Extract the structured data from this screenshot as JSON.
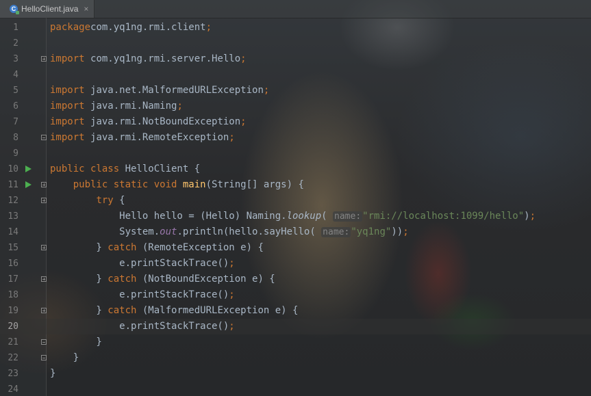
{
  "tab": {
    "icon": "java-class-icon",
    "icon_letter": "C",
    "label": "HelloClient.java",
    "close": "×"
  },
  "lines": [
    {
      "n": "1",
      "t": [
        [
          "kw",
          "package"
        ],
        [
          "",
          "com.yq1ng.rmi.client"
        ],
        [
          "kw",
          ";"
        ]
      ]
    },
    {
      "n": "2",
      "t": []
    },
    {
      "n": "3",
      "t": [
        [
          "kw",
          "import "
        ],
        [
          "",
          "com.yq1ng.rmi.server.Hello"
        ],
        [
          "kw",
          ";"
        ]
      ]
    },
    {
      "n": "4",
      "t": []
    },
    {
      "n": "5",
      "t": [
        [
          "kw",
          "import "
        ],
        [
          "",
          "java.net.MalformedURLException"
        ],
        [
          "kw",
          ";"
        ]
      ]
    },
    {
      "n": "6",
      "t": [
        [
          "kw",
          "import "
        ],
        [
          "",
          "java.rmi.Naming"
        ],
        [
          "kw",
          ";"
        ]
      ]
    },
    {
      "n": "7",
      "t": [
        [
          "kw",
          "import "
        ],
        [
          "",
          "java.rmi.NotBoundException"
        ],
        [
          "kw",
          ";"
        ]
      ]
    },
    {
      "n": "8",
      "t": [
        [
          "kw",
          "import "
        ],
        [
          "",
          "java.rmi.RemoteException"
        ],
        [
          "kw",
          ";"
        ]
      ]
    },
    {
      "n": "9",
      "t": []
    },
    {
      "n": "10",
      "t": [
        [
          "kw",
          "public class "
        ],
        [
          "",
          "HelloClient {"
        ]
      ]
    },
    {
      "n": "11",
      "t": [
        [
          "",
          "    "
        ],
        [
          "kw",
          "public static void "
        ],
        [
          "fn",
          "main"
        ],
        [
          "",
          "(String[] args) {"
        ]
      ]
    },
    {
      "n": "12",
      "t": [
        [
          "",
          "        "
        ],
        [
          "kw",
          "try "
        ],
        [
          "",
          "{"
        ]
      ]
    },
    {
      "n": "13",
      "t": [
        [
          "",
          "            Hello hello = (Hello) Naming."
        ],
        [
          "it",
          "lookup"
        ],
        [
          "",
          "( "
        ],
        [
          "hint",
          "name:"
        ],
        [
          "",
          ""
        ],
        [
          "str",
          "\"rmi://localhost:1099/hello\""
        ],
        [
          "",
          ")"
        ],
        [
          "kw",
          ";"
        ]
      ]
    },
    {
      "n": "14",
      "t": [
        [
          "",
          "            System."
        ],
        [
          "fld",
          "out"
        ],
        [
          "",
          ".println(hello.sayHello( "
        ],
        [
          "hint",
          "name:"
        ],
        [
          "",
          ""
        ],
        [
          "str",
          "\"yq1ng\""
        ],
        [
          "",
          "))"
        ],
        [
          "kw",
          ";"
        ]
      ]
    },
    {
      "n": "15",
      "t": [
        [
          "",
          "        } "
        ],
        [
          "kw",
          "catch "
        ],
        [
          "",
          "(RemoteException e) {"
        ]
      ]
    },
    {
      "n": "16",
      "t": [
        [
          "",
          "            e.printStackTrace()"
        ],
        [
          "kw",
          ";"
        ]
      ]
    },
    {
      "n": "17",
      "t": [
        [
          "",
          "        } "
        ],
        [
          "kw",
          "catch "
        ],
        [
          "",
          "(NotBoundException e) {"
        ]
      ]
    },
    {
      "n": "18",
      "t": [
        [
          "",
          "            e.printStackTrace()"
        ],
        [
          "kw",
          ";"
        ]
      ]
    },
    {
      "n": "19",
      "t": [
        [
          "",
          "        } "
        ],
        [
          "kw",
          "catch "
        ],
        [
          "",
          "(MalformedURLException e) {"
        ]
      ]
    },
    {
      "n": "20",
      "t": [
        [
          "",
          "            e.printStackTrace()"
        ],
        [
          "kw",
          ";"
        ]
      ]
    },
    {
      "n": "21",
      "t": [
        [
          "",
          "        }"
        ]
      ]
    },
    {
      "n": "22",
      "t": [
        [
          "",
          "    }"
        ]
      ]
    },
    {
      "n": "23",
      "t": [
        [
          "",
          "}"
        ]
      ]
    },
    {
      "n": "24",
      "t": []
    }
  ],
  "current_line": "20",
  "run_gutter_lines": [
    "10",
    "11"
  ],
  "colors": {
    "keyword": "#cc7832",
    "identifier": "#a9b7c6",
    "method": "#ffc66d",
    "string": "#6a8759",
    "static_field": "#9876aa",
    "line_number": "#7a7a7a",
    "run_icon": "#4caf50"
  }
}
